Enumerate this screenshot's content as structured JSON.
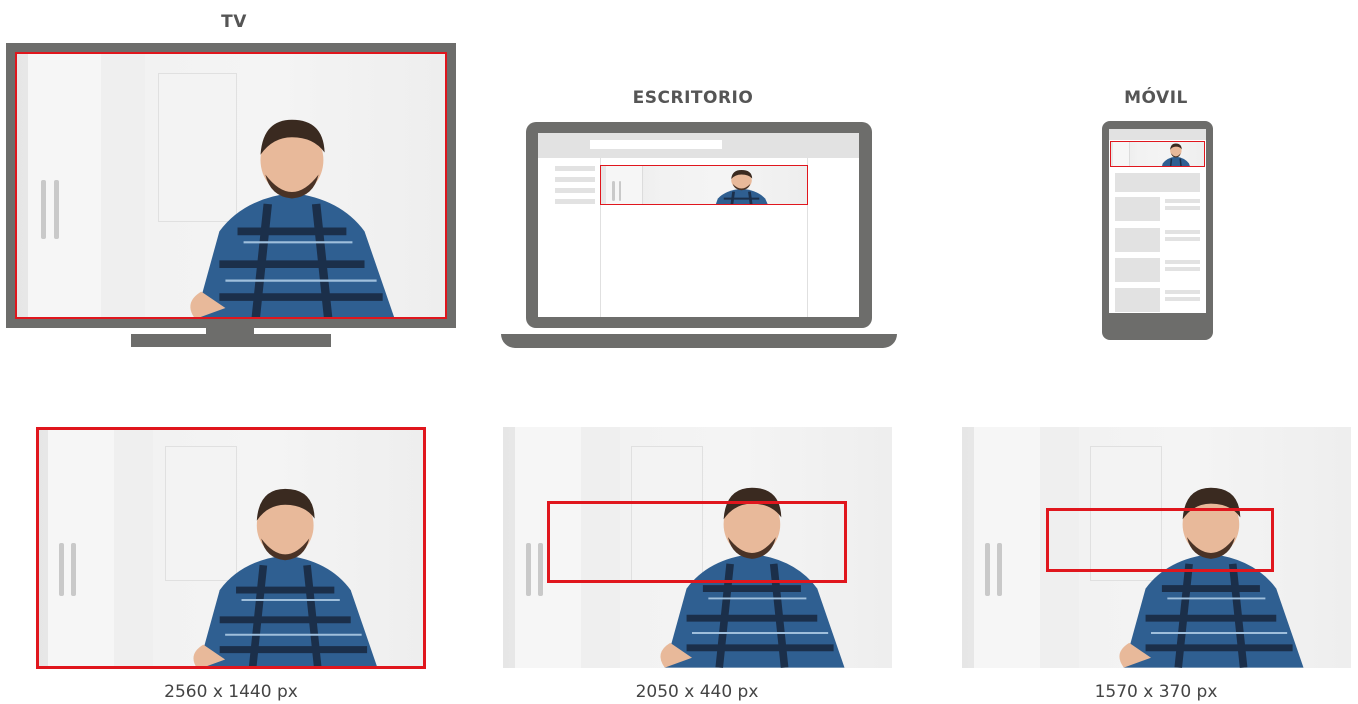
{
  "devices": {
    "tv": {
      "title": "TV",
      "size": "2560 x 1440 px"
    },
    "desktop": {
      "title": "ESCRITORIO",
      "size": "2050 x 440 px"
    },
    "mobile": {
      "title": "MÓVIL",
      "size": "1570 x 370 px"
    }
  },
  "colors": {
    "frame": "#6d6d6b",
    "highlight": "#e0161d",
    "shirt": "#2f5f91",
    "background": "#ffffff"
  }
}
